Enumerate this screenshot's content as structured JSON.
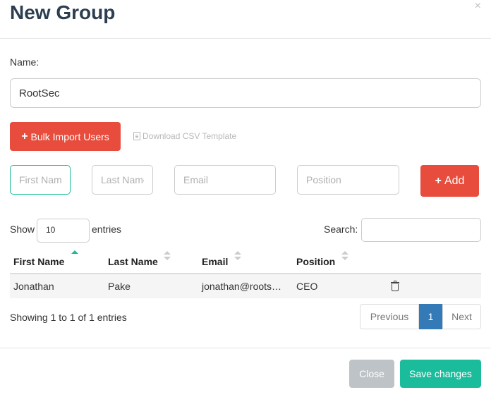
{
  "modal": {
    "title": "New Group",
    "close_symbol": "×"
  },
  "form": {
    "name_label": "Name:",
    "name_value": "RootSec",
    "bulk_import_label": "Bulk Import Users",
    "download_csv_label": "Download CSV Template",
    "plus_symbol": "+",
    "fields": {
      "first_name_placeholder": "First Name",
      "last_name_placeholder": "Last Name",
      "email_placeholder": "Email",
      "position_placeholder": "Position"
    },
    "add_label": "Add"
  },
  "table": {
    "show_label": "Show",
    "page_size": "10",
    "entries_label": "entries",
    "search_label": "Search:",
    "columns": [
      "First Name",
      "Last Name",
      "Email",
      "Position"
    ],
    "rows": [
      {
        "first": "Jonathan",
        "last": "Pake",
        "email": "jonathan@roots…",
        "position": "CEO"
      }
    ],
    "info": "Showing 1 to 1 of 1 entries",
    "pagination": {
      "previous": "Previous",
      "current": "1",
      "next": "Next"
    }
  },
  "footer": {
    "close_label": "Close",
    "save_label": "Save changes"
  },
  "colors": {
    "danger": "#e74c3c",
    "success": "#1abc9c",
    "primary": "#337ab7",
    "muted": "#bdc3c7"
  },
  "icons": {
    "download": "file-icon",
    "delete": "trash-icon",
    "sort": "sort-icon"
  }
}
